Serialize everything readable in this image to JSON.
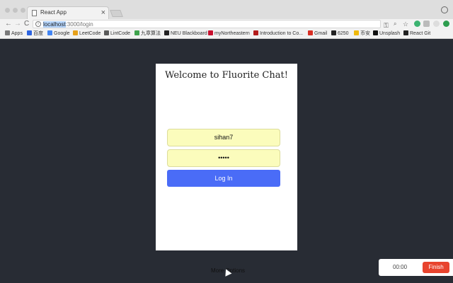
{
  "browser": {
    "tab_title": "React App",
    "tab_close": "×",
    "url_host": "localhost",
    "url_path": ":3000/login",
    "nav": {
      "back": "←",
      "forward": "→",
      "reload": "C"
    },
    "toolbar_icons": {
      "key": "⚿",
      "zoom": "🔍",
      "star": "☆"
    },
    "bookmarks": [
      {
        "label": "Apps",
        "color": "#7a7a7a"
      },
      {
        "label": "百度",
        "color": "#2d64e0"
      },
      {
        "label": "Google",
        "color": "#4285f4"
      },
      {
        "label": "LeetCode",
        "color": "#e7a11b"
      },
      {
        "label": "LintCode",
        "color": "#5a5a5a"
      },
      {
        "label": "九章算法",
        "color": "#3fa34d"
      },
      {
        "label": "NEU Blackboard",
        "color": "#222222"
      },
      {
        "label": "myNortheastern",
        "color": "#c8102e"
      },
      {
        "label": "Introduction to Co...",
        "color": "#b31b1b"
      },
      {
        "label": "Gmail",
        "color": "#d93025"
      },
      {
        "label": "6250",
        "color": "#222222"
      },
      {
        "label": "币安",
        "color": "#f0b90b"
      },
      {
        "label": "Unsplash",
        "color": "#111111"
      },
      {
        "label": "React Git",
        "color": "#222222"
      }
    ]
  },
  "login": {
    "title": "Welcome to Fluorite Chat!",
    "username_value": "sihan7",
    "password_value": "•••••",
    "login_label": "Log In"
  },
  "footer": {
    "more_options": "More Options"
  },
  "recorder": {
    "time": "00:00",
    "finish_label": "Finish"
  },
  "colors": {
    "background": "#282c34",
    "login_button": "#4a6cf7",
    "field_fill": "#fbfcbc",
    "finish_button": "#e8442e"
  }
}
